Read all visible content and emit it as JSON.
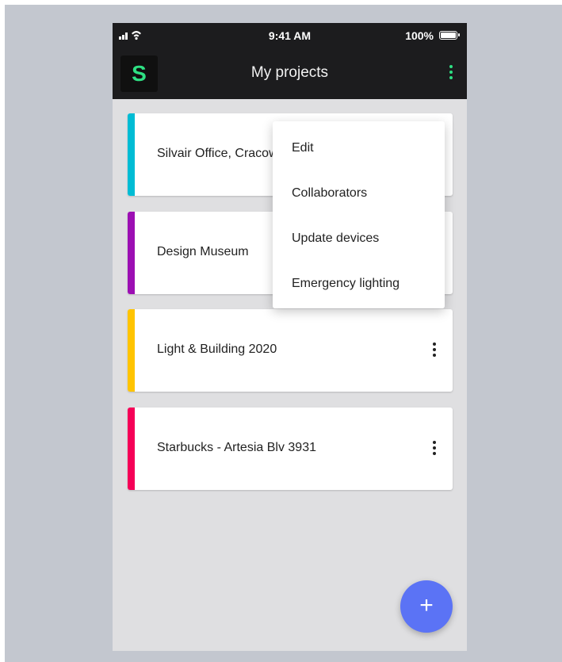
{
  "status_bar": {
    "time": "9:41 AM",
    "battery": "100%"
  },
  "app_bar": {
    "logo": "S",
    "title": "My projects",
    "accent": "#2ee083"
  },
  "projects": [
    {
      "name": "Silvair Office, Cracow",
      "color": "#00bcd4"
    },
    {
      "name": "Design Museum",
      "color": "#9c0fb3"
    },
    {
      "name": "Light & Building 2020",
      "color": "#ffc400"
    },
    {
      "name": "Starbucks - Artesia Blv 3931",
      "color": "#f50057"
    }
  ],
  "menu": {
    "items": [
      "Edit",
      "Collaborators",
      "Update devices",
      "Emergency lighting"
    ]
  },
  "fab": {
    "label": "+",
    "color": "#5b73f5"
  }
}
